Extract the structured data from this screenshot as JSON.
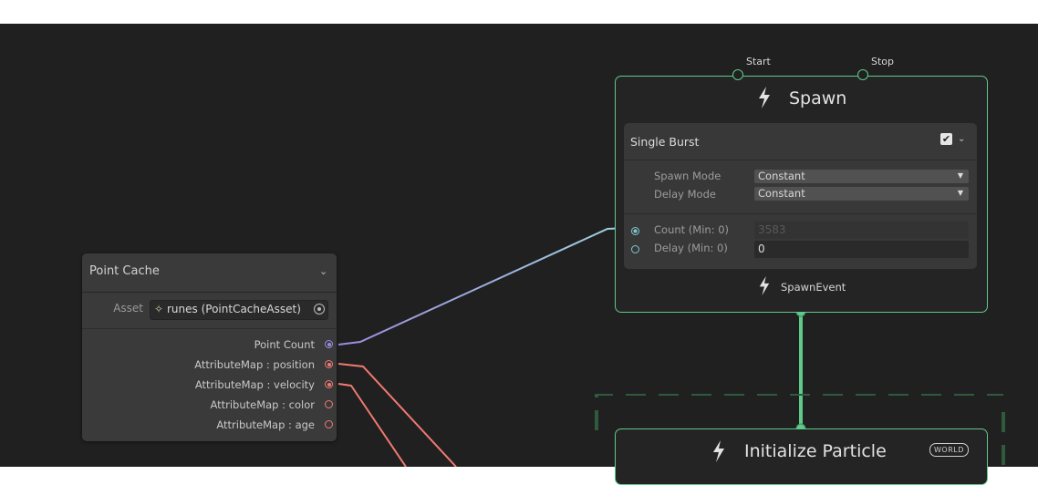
{
  "point_cache": {
    "title": "Point Cache",
    "asset_label": "Asset",
    "asset_value": "runes (PointCacheAsset)",
    "outputs": [
      {
        "label": "Point Count",
        "color": "#9d8be0",
        "filled": true
      },
      {
        "label": "AttributeMap : position",
        "color": "#f07a72",
        "filled": true
      },
      {
        "label": "AttributeMap : velocity",
        "color": "#f07a72",
        "filled": true
      },
      {
        "label": "AttributeMap : color",
        "color": "#f07a72",
        "filled": false
      },
      {
        "label": "AttributeMap : age",
        "color": "#f07a72",
        "filled": false
      }
    ]
  },
  "spawn": {
    "flow_inputs": [
      "Start",
      "Stop"
    ],
    "title": "Spawn",
    "block": {
      "title": "Single Burst",
      "spawn_mode_label": "Spawn Mode",
      "spawn_mode_value": "Constant",
      "delay_mode_label": "Delay Mode",
      "delay_mode_value": "Constant",
      "count_label": "Count (Min: 0)",
      "count_value": "3583",
      "delay_label": "Delay (Min: 0)",
      "delay_value": "0"
    },
    "output_label": "SpawnEvent"
  },
  "initialize": {
    "title": "Initialize Particle",
    "space_badge": "WORLD"
  },
  "colors": {
    "flow_green": "#5fc98a",
    "wire_float": "#7fc6cf",
    "wire_uint": "#9d8be0",
    "wire_vector": "#f07a72"
  }
}
